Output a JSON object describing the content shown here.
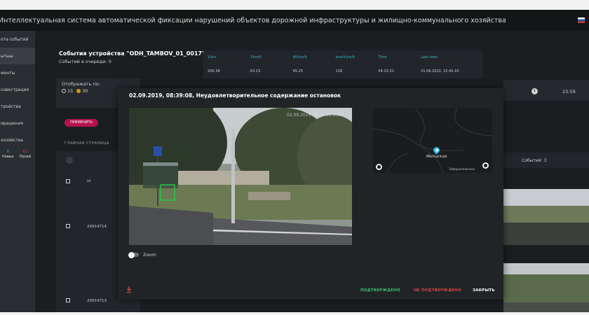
{
  "header": {
    "title": "Интеллектуальная система автоматической фиксации нарушений объектов дорожной инфраструктуры и жилищно-коммунального хозяйства"
  },
  "sidebar": {
    "items": [
      {
        "label": "ота событий"
      },
      {
        "label": "ытыы"
      },
      {
        "label": "менты"
      },
      {
        "label": "нзвкстрация"
      },
      {
        "label": "тройства"
      },
      {
        "label": "ирашения"
      },
      {
        "label": "хозяйства"
      }
    ],
    "stats": [
      {
        "value": "8",
        "label": "Новых"
      },
      {
        "value": "63",
        "label": "Прсий"
      }
    ]
  },
  "device": {
    "title": "События устройства \"ODH_TAMBOV_01_0017\":",
    "queue": "Событий в очереди: 0"
  },
  "stats_table": {
    "headers": [
      "V.km",
      "Y.km/h",
      "AV.km/h",
      "maxV.km/h",
      "Time",
      "Last seen"
    ],
    "values": [
      "206.38",
      "63.23",
      "65.25",
      "118",
      "04:10:31",
      "21.08.2022, 15:41:10"
    ]
  },
  "filter": {
    "label": "Отображать по:",
    "options": [
      "15",
      "30"
    ],
    "selected": "30",
    "apply_label": "ПРИМЕНИТЬ"
  },
  "breadcrumb": "ГЛАВНАЯ СТРАНИЦА",
  "table": {
    "column_id": "id",
    "rows": [
      {
        "id": "20914714"
      },
      {
        "id": "20914713"
      }
    ]
  },
  "right": {
    "time": "23:59",
    "events": "Событий: 3"
  },
  "modal": {
    "title": "02.09.2019, 08:39:08, Неудовлетворительное содержание остановок",
    "photo_timestamp": "02.09.2019 08:39:08 2019",
    "zoom_label": "Zoom",
    "map_city": "Michurinsk",
    "map_sub": "Заворонежское",
    "confirm": "ПОДТВЕРЖДЕНО",
    "reject": "НЕ ПОДТВЕРЖДЕНО",
    "close": "ЗАКРЫТЬ"
  },
  "colors": {
    "green": "#3cbf6a",
    "red": "#d64545",
    "accent": "#b3124d",
    "bbox": "#27c24a"
  }
}
